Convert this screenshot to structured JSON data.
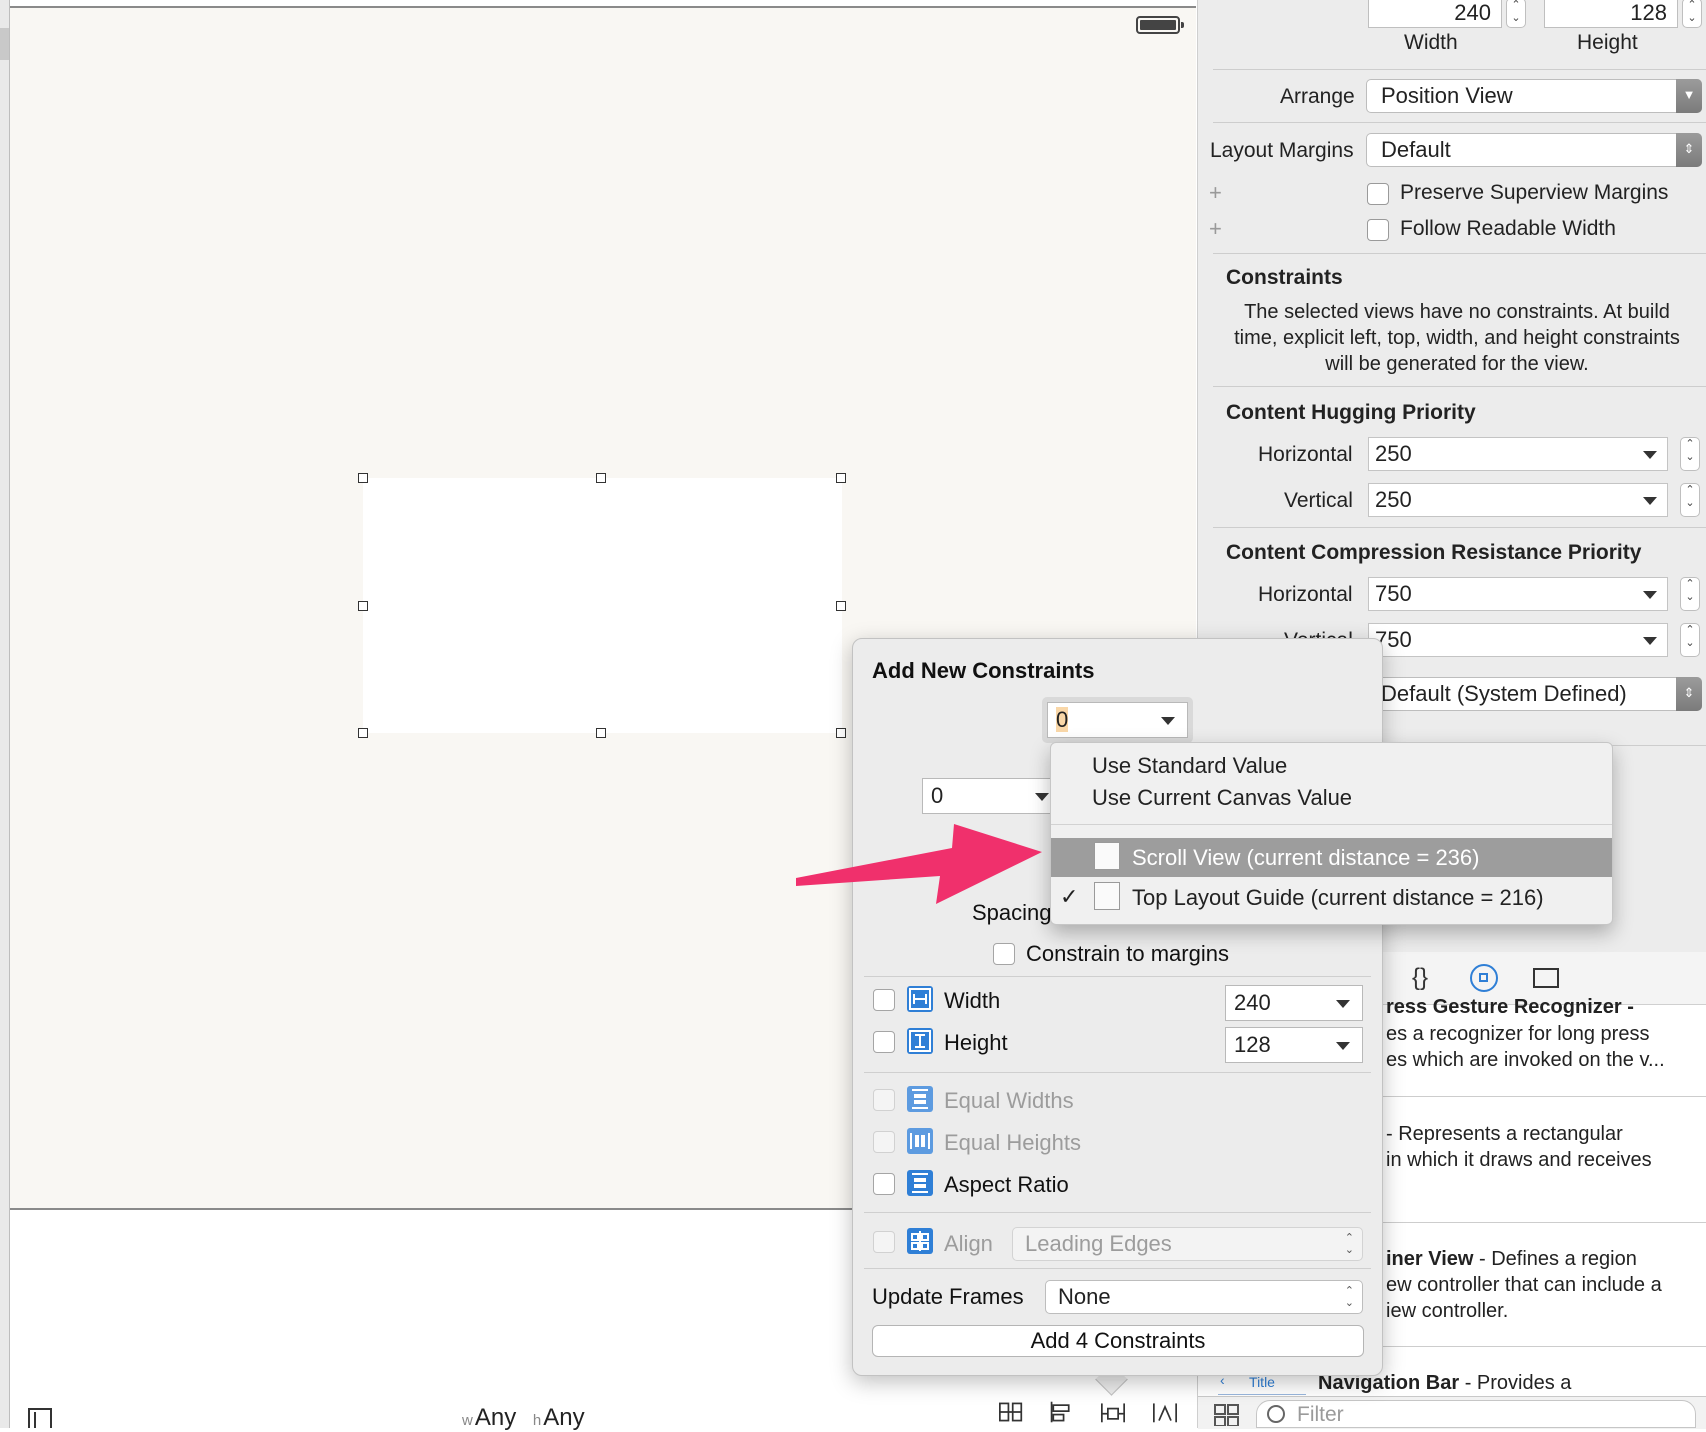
{
  "canvas": {
    "size_class": {
      "w_prefix": "w",
      "w_value": "Any",
      "h_prefix": "h",
      "h_value": "Any"
    }
  },
  "inspector": {
    "size": {
      "width_value": "240",
      "height_value": "128",
      "width_label": "Width",
      "height_label": "Height"
    },
    "arrange": {
      "label": "Arrange",
      "value": "Position View"
    },
    "layout_margins": {
      "label": "Layout Margins",
      "value": "Default"
    },
    "preserve_superview_margins": "Preserve Superview Margins",
    "follow_readable_width": "Follow Readable Width",
    "constraints": {
      "title": "Constraints",
      "description_lines": [
        "The selected views have no constraints. At build",
        "time, explicit left, top, width, and height constraints",
        "will be generated for the view."
      ]
    },
    "hugging": {
      "title": "Content Hugging Priority",
      "horizontal_label": "Horizontal",
      "horizontal_value": "250",
      "vertical_label": "Vertical",
      "vertical_value": "250"
    },
    "compression": {
      "title": "Content Compression Resistance Priority",
      "horizontal_label": "Horizontal",
      "horizontal_value": "750",
      "vertical_label": "Vertical",
      "vertical_value": "750"
    },
    "intrinsic_size": {
      "value": "Default (System Defined)"
    },
    "library": {
      "item1_title_partial": "ress Gesture Recognizer -",
      "item1_line1": "es a recognizer for long press",
      "item1_line2": "es which are invoked on the v...",
      "item2_line1": "- Represents a rectangular",
      "item2_line2": "in which it draws and receives",
      "item3_title_partial": "iner View",
      "item3_line1_rest": " - Defines a region",
      "item3_line2": "ew controller that can include a",
      "item3_line3": "iew controller.",
      "item4_badge": "Title",
      "item4_title": "Navigation Bar",
      "item4_rest": " - Provides a"
    },
    "filter_placeholder": "Filter"
  },
  "popover": {
    "title": "Add New Constraints",
    "top_value": "0",
    "left_value": "0",
    "spacing_label": "Spacing",
    "constrain_to_margins": "Constrain to margins",
    "width_label": "Width",
    "width_value": "240",
    "height_label": "Height",
    "height_value": "128",
    "equal_widths": "Equal Widths",
    "equal_heights": "Equal Heights",
    "aspect_ratio": "Aspect Ratio",
    "align_label": "Align",
    "align_value": "Leading Edges",
    "update_frames_label": "Update Frames",
    "update_frames_value": "None",
    "add_button": "Add 4 Constraints"
  },
  "menu": {
    "item_standard": "Use Standard Value",
    "item_canvas": "Use Current Canvas Value",
    "item_scroll_view": "Scroll View (current distance = 236)",
    "item_top_guide": "Top Layout Guide (current distance = 216)",
    "checkmark": "✓"
  },
  "colors": {
    "accent_blue": "#2f7fd6",
    "arrow_pink": "#f0306c",
    "menu_highlight": "#9d9d9d",
    "scene_background": "#f9f7f3"
  }
}
